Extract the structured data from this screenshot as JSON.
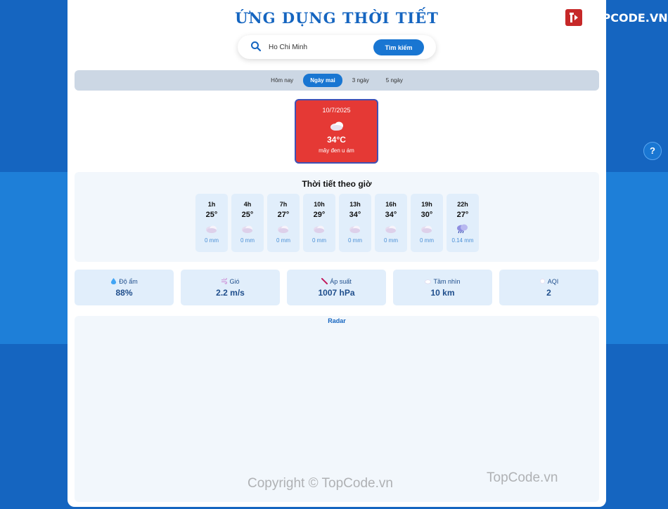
{
  "app": {
    "title": "ỨNG DỤNG THỜI TIẾT"
  },
  "brand": {
    "logo_text": "TOPCODE.VN"
  },
  "search": {
    "value": "Ho Chi Minh",
    "button_label": "Tìm kiếm"
  },
  "tabs": [
    {
      "label": "Hôm nay",
      "active": false
    },
    {
      "label": "Ngày mai",
      "active": true
    },
    {
      "label": "3 ngày",
      "active": false
    },
    {
      "label": "5 ngày",
      "active": false
    }
  ],
  "day_card": {
    "date": "10/7/2025",
    "icon": "cloud-icon",
    "temp": "34°C",
    "desc": "mây đen u ám"
  },
  "hourly": {
    "title": "Thời tiết theo giờ",
    "items": [
      {
        "hour": "1h",
        "temp": "25°",
        "icon": "cloud-icon",
        "rain": "0 mm"
      },
      {
        "hour": "4h",
        "temp": "25°",
        "icon": "cloud-icon",
        "rain": "0 mm"
      },
      {
        "hour": "7h",
        "temp": "27°",
        "icon": "cloud-icon",
        "rain": "0 mm"
      },
      {
        "hour": "10h",
        "temp": "29°",
        "icon": "cloud-icon",
        "rain": "0 mm"
      },
      {
        "hour": "13h",
        "temp": "34°",
        "icon": "cloud-icon",
        "rain": "0 mm"
      },
      {
        "hour": "16h",
        "temp": "34°",
        "icon": "cloud-icon",
        "rain": "0 mm"
      },
      {
        "hour": "19h",
        "temp": "30°",
        "icon": "cloud-icon",
        "rain": "0 mm"
      },
      {
        "hour": "22h",
        "temp": "27°",
        "icon": "rain-cloud-icon",
        "rain": "0.14 mm"
      }
    ]
  },
  "stats": [
    {
      "label": "Độ ẩm",
      "value": "88%",
      "icon": "droplet-icon"
    },
    {
      "label": "Gió",
      "value": "2.2 m/s",
      "icon": "wind-icon"
    },
    {
      "label": "Áp suất",
      "value": "1007 hPa",
      "icon": "pressure-icon"
    },
    {
      "label": "Tầm nhìn",
      "value": "10 km",
      "icon": "visibility-icon"
    },
    {
      "label": "AQI",
      "value": "2",
      "icon": "aqi-icon"
    }
  ],
  "radar": {
    "title": "Radar"
  },
  "watermarks": [
    "Copyright © TopCode.vn",
    "TopCode.vn"
  ],
  "help": {
    "label": "?"
  },
  "colors": {
    "accent": "#1976d2",
    "day_card_bg": "#e53935",
    "title": "#1565c0"
  }
}
